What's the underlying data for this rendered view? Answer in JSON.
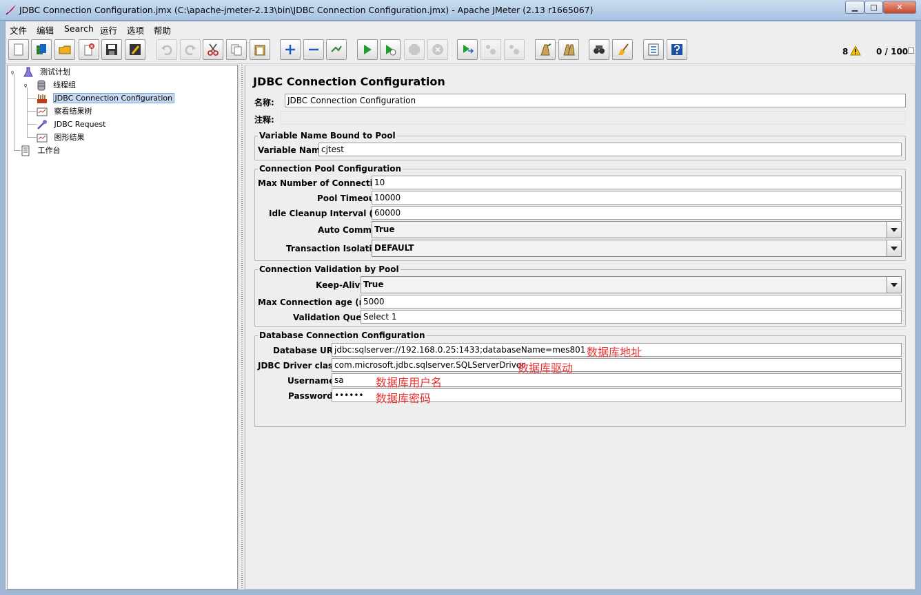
{
  "window": {
    "title": "JDBC Connection Configuration.jmx (C:\\apache-jmeter-2.13\\bin\\JDBC Connection Configuration.jmx) - Apache JMeter (2.13 r1665067)",
    "min_label": "▁",
    "max_label": "□",
    "close_label": "✕"
  },
  "menu": [
    "文件",
    "编辑",
    "Search",
    "运行",
    "选项",
    "帮助"
  ],
  "toolbar": {
    "buttons": [
      {
        "icon": "new-icon"
      },
      {
        "icon": "templates-icon"
      },
      {
        "icon": "open-icon"
      },
      {
        "icon": "close-file-icon"
      },
      {
        "icon": "save-icon"
      },
      {
        "icon": "save-as-icon"
      },
      {
        "icon": "undo-icon"
      },
      {
        "icon": "redo-icon"
      },
      {
        "icon": "cut-icon"
      },
      {
        "icon": "copy-icon"
      },
      {
        "icon": "paste-icon"
      },
      {
        "icon": "expand-icon"
      },
      {
        "icon": "collapse-icon"
      },
      {
        "icon": "toggle-icon"
      },
      {
        "icon": "start-icon"
      },
      {
        "icon": "start-no-pause-icon"
      },
      {
        "icon": "stop-icon"
      },
      {
        "icon": "shutdown-icon"
      },
      {
        "icon": "remote-start-icon"
      },
      {
        "icon": "remote-stop-icon"
      },
      {
        "icon": "remote-shutdown-icon"
      },
      {
        "icon": "clear-icon"
      },
      {
        "icon": "clear-all-icon"
      },
      {
        "icon": "search-icon"
      },
      {
        "icon": "reset-search-icon"
      },
      {
        "icon": "function-helper-icon"
      },
      {
        "icon": "help-icon"
      }
    ],
    "warning_count": "8",
    "thread_count": "0 / 100"
  },
  "tree": [
    {
      "label": "测试计划",
      "icon": "test-plan-icon",
      "level": 0
    },
    {
      "label": "线程组",
      "icon": "thread-group-icon",
      "level": 1
    },
    {
      "label": "JDBC Connection Configuration",
      "icon": "jdbc-config-icon",
      "level": 2,
      "selected": true
    },
    {
      "label": "察看结果树",
      "icon": "listener-icon",
      "level": 2
    },
    {
      "label": "JDBC Request",
      "icon": "sampler-icon",
      "level": 2
    },
    {
      "label": "图形结果",
      "icon": "listener-icon",
      "level": 2
    },
    {
      "label": "工作台",
      "icon": "workbench-icon",
      "level": 0
    }
  ],
  "config": {
    "title": "JDBC Connection Configuration",
    "name_label": "名称:",
    "name_value": "JDBC Connection Configuration",
    "comment_label": "注释:",
    "comment_value": "",
    "variable_group": {
      "title": "Variable Name Bound to Pool",
      "variable_name_label": "Variable Name:",
      "variable_name_value": "cjtest"
    },
    "pool_group": {
      "title": "Connection Pool Configuration",
      "max_connections_label": "Max Number of Connections:",
      "max_connections_value": "10",
      "pool_timeout_label": "Pool Timeout:",
      "pool_timeout_value": "10000",
      "idle_cleanup_label": "Idle Cleanup Interval (ms):",
      "idle_cleanup_value": "60000",
      "auto_commit_label": "Auto Commit:",
      "auto_commit_value": "True",
      "isolation_label": "Transaction Isolation:",
      "isolation_value": "DEFAULT"
    },
    "validation_group": {
      "title": "Connection Validation by Pool",
      "keep_alive_label": "Keep-Alive:",
      "keep_alive_value": "True",
      "max_age_label": "Max Connection age (ms):",
      "max_age_value": "5000",
      "validation_query_label": "Validation Query:",
      "validation_query_value": "Select 1"
    },
    "database_group": {
      "title": "Database Connection Configuration",
      "url_label": "Database URL:",
      "url_value": "jdbc:sqlserver://192.168.0.25:1433;databaseName=mes801",
      "url_note": "数据库地址",
      "driver_label": "JDBC Driver class:",
      "driver_value": "com.microsoft.jdbc.sqlserver.SQLServerDriver",
      "driver_note": "数据库驱动",
      "username_label": "Username:",
      "username_value": "sa",
      "username_note": "数据库用户名",
      "password_label": "Password:",
      "password_value": "••••••",
      "password_note": "数据库密码"
    }
  }
}
